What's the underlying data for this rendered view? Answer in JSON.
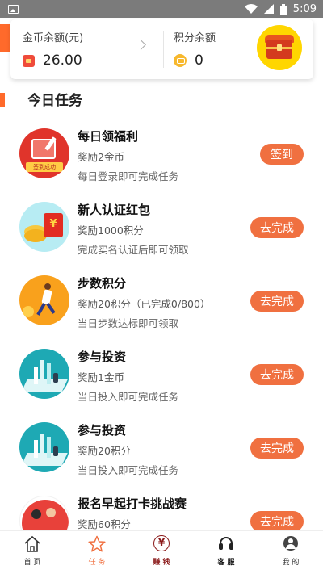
{
  "status_bar": {
    "time": "5:09",
    "icons": [
      "image-icon",
      "wifi-icon",
      "signal-icon",
      "battery-icon"
    ]
  },
  "balance": {
    "coin_label": "金币余额(元)",
    "coin_value": "26.00",
    "points_label": "积分余额",
    "points_value": "0"
  },
  "section": {
    "title": "今日任务"
  },
  "tasks": [
    {
      "title": "每日领福利",
      "reward": "奖励2金币",
      "desc": "每日登录即可完成任务",
      "button": "签到",
      "icon": "sign-in-icon",
      "badge": "签到成功"
    },
    {
      "title": "新人认证红包",
      "reward": "奖励1000积分",
      "desc": "完成实名认证后即可领取",
      "button": "去完成",
      "icon": "red-envelope-icon"
    },
    {
      "title": "步数积分",
      "reward": "奖励20积分（已完成0/800）",
      "desc": "当日步数达标即可领取",
      "button": "去完成",
      "icon": "runner-icon"
    },
    {
      "title": "参与投资",
      "reward": "奖励1金币",
      "desc": "当日投入即可完成任务",
      "button": "去完成",
      "icon": "investment-chart-icon"
    },
    {
      "title": "参与投资",
      "reward": "奖励20积分",
      "desc": "当日投入即可完成任务",
      "button": "去完成",
      "icon": "investment-chart-icon"
    },
    {
      "title": "报名早起打卡挑战赛",
      "reward": "奖励60积分",
      "desc": "",
      "button": "去完成",
      "icon": "challenge-icon"
    }
  ],
  "tabbar": [
    {
      "label": "首 页",
      "icon": "home-icon"
    },
    {
      "label": "任 务",
      "icon": "star-icon",
      "active": true
    },
    {
      "label": "赚 钱",
      "icon": "yen-icon"
    },
    {
      "label": "客 服",
      "icon": "headset-icon"
    },
    {
      "label": "我 的",
      "icon": "profile-icon"
    }
  ],
  "colors": {
    "accent": "#f07040",
    "brand_orange": "#ff6a2b"
  }
}
